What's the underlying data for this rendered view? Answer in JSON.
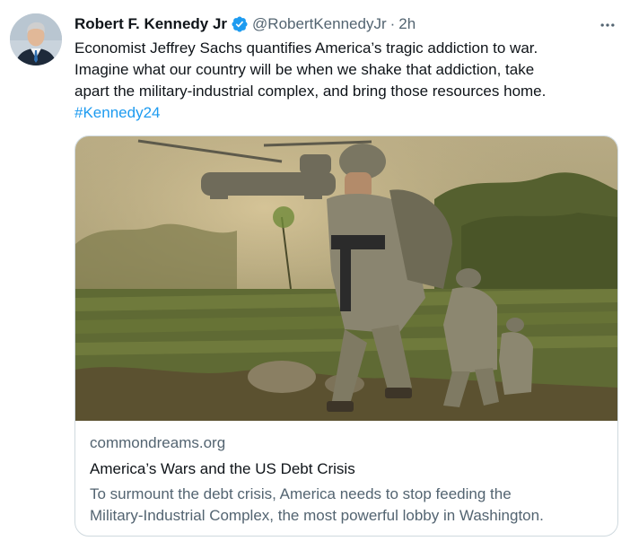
{
  "tweet": {
    "author_name": "Robert F. Kennedy Jr",
    "handle": "@RobertKennedyJr",
    "separator": "·",
    "time": "2h",
    "text_line1": "Economist Jeffrey Sachs quantifies America’s tragic addiction to war.",
    "text_line2": "Imagine what our country will be when we shake that addiction, take",
    "text_line3": "apart the military-industrial complex, and bring those resources home.",
    "hashtag": "#Kennedy24",
    "icons": {
      "verified": "verified-badge-icon",
      "more": "more-horizontal-icon"
    }
  },
  "card": {
    "domain": "commondreams.org",
    "title": "America’s Wars and the US Debt Crisis",
    "description_line1": "To surmount the debt crisis, America needs to stop feeding the",
    "description_line2": "Military-Industrial Complex, the most powerful lobby in Washington."
  },
  "colors": {
    "text": "#0f1419",
    "secondary": "#536471",
    "link": "#1d9bf0",
    "border": "#cfd9de"
  }
}
